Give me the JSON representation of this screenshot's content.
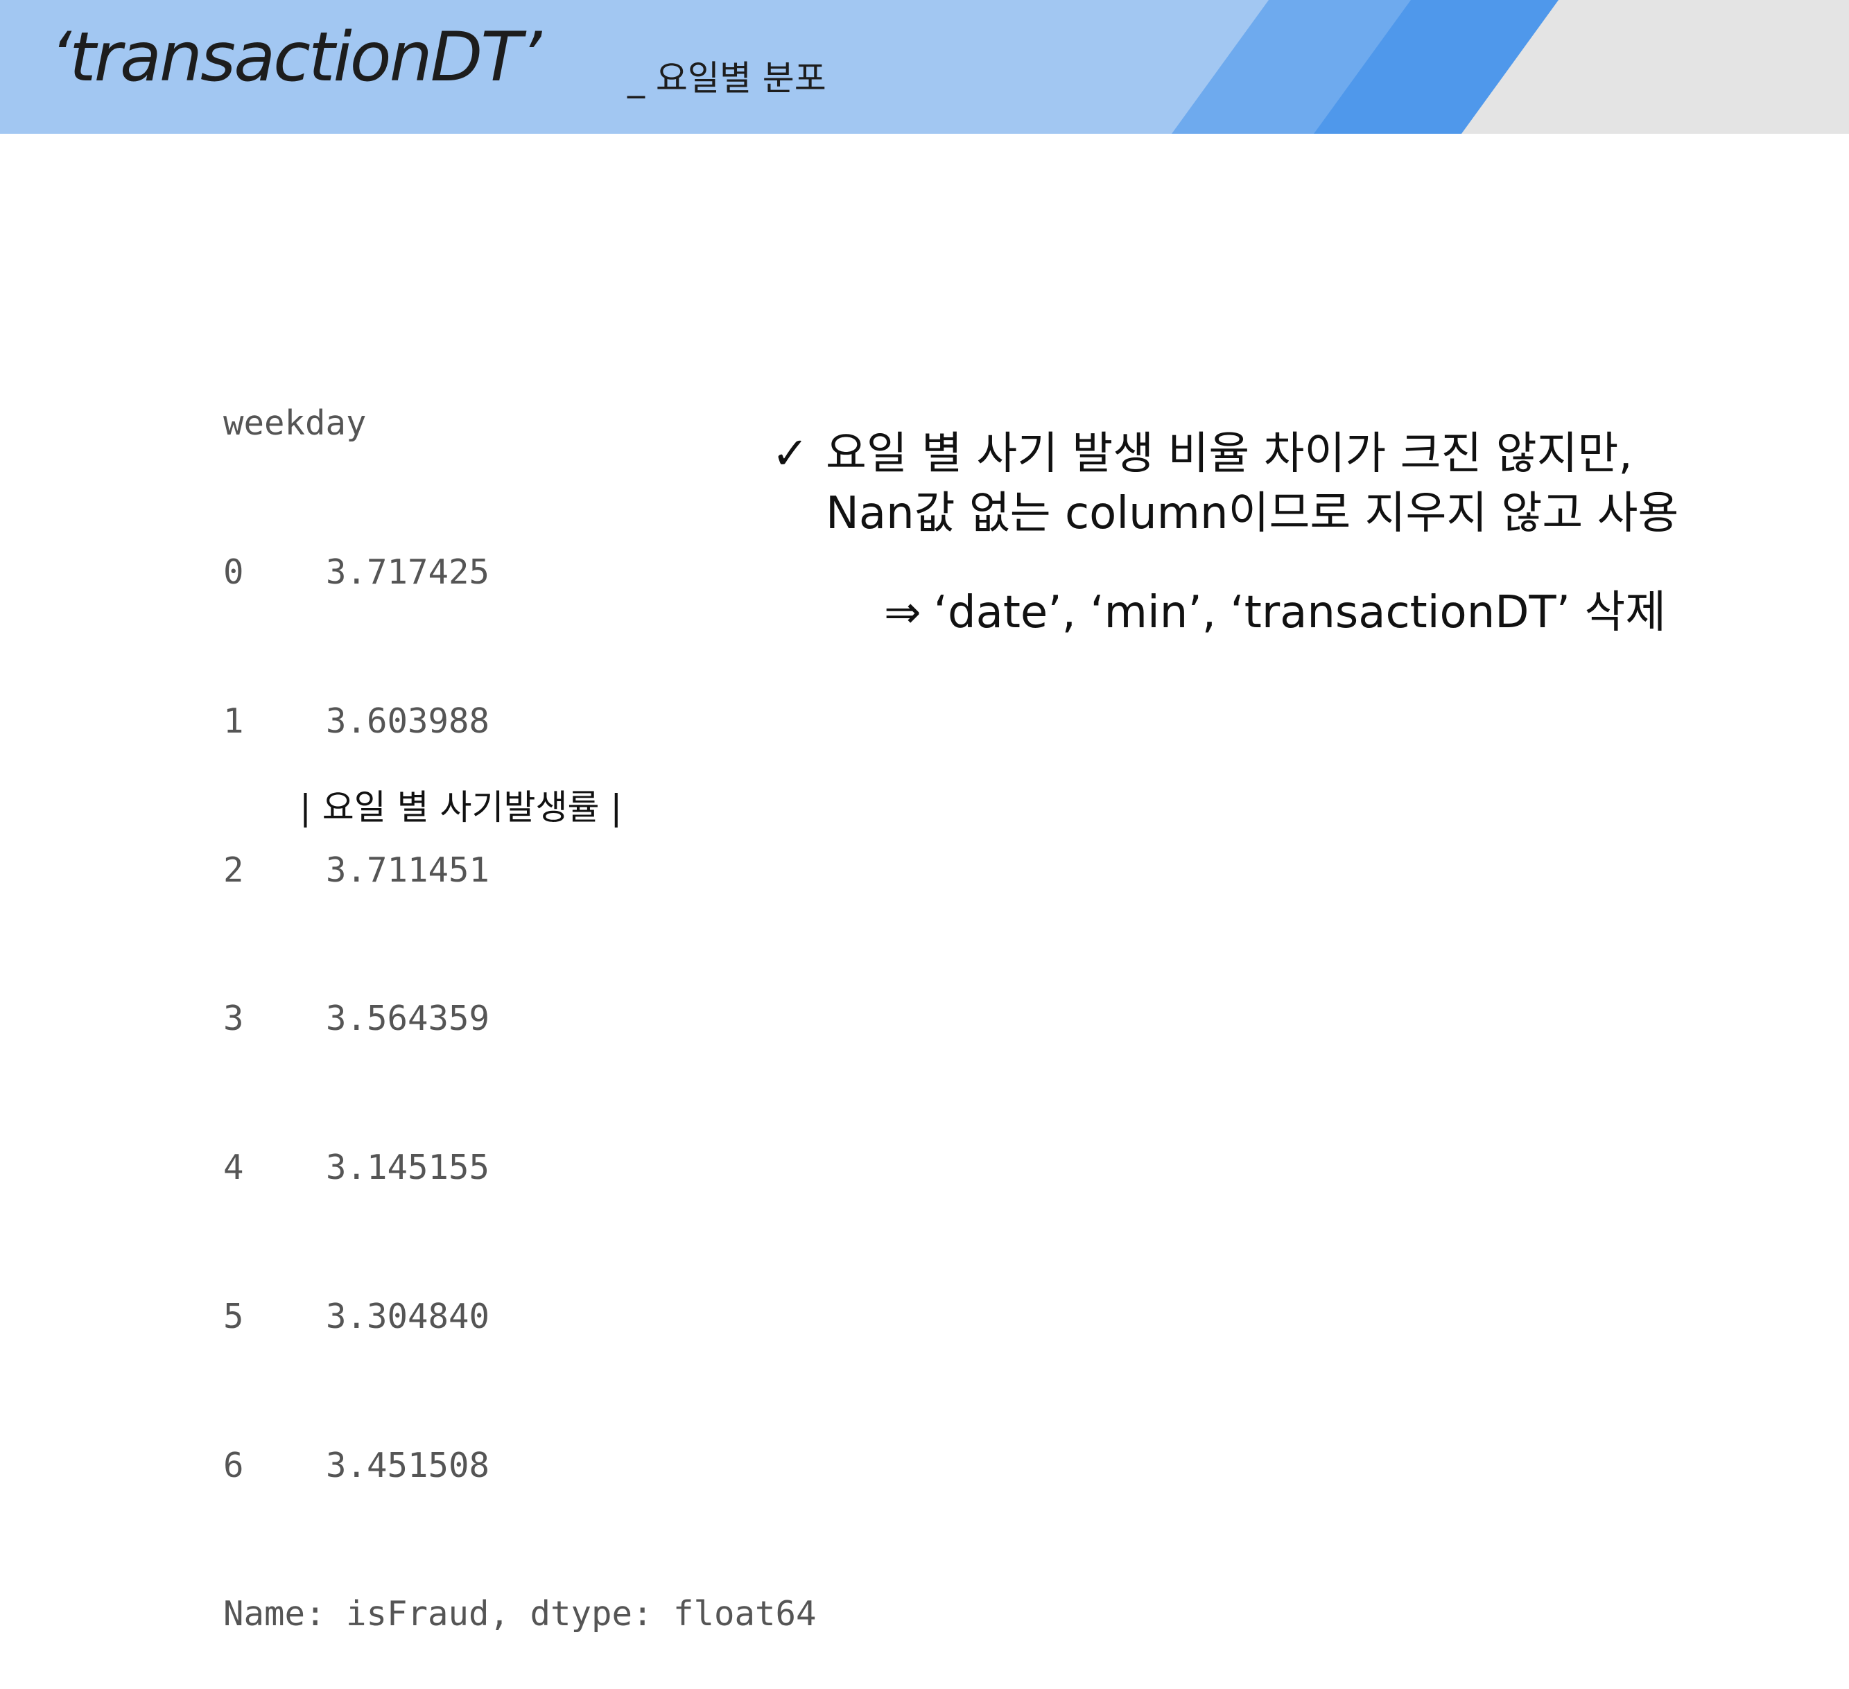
{
  "header": {
    "title": "‘transactionDT’",
    "subtitle": "_ 요일별 분포",
    "colors": {
      "band_light": "#a2c7f2",
      "stripe_mid": "#6eaaee",
      "stripe_dark": "#4f98eb",
      "corner_gray": "#e4e4e4"
    }
  },
  "output": {
    "header": "weekday",
    "rows": [
      {
        "index": "0",
        "value": "3.717425"
      },
      {
        "index": "1",
        "value": "3.603988"
      },
      {
        "index": "2",
        "value": "3.711451"
      },
      {
        "index": "3",
        "value": "3.564359"
      },
      {
        "index": "4",
        "value": "3.145155"
      },
      {
        "index": "5",
        "value": "3.304840"
      },
      {
        "index": "6",
        "value": "3.451508"
      }
    ],
    "footer": "Name: isFraud, dtype: float64",
    "caption": "| 요일 별 사기발생률 |"
  },
  "note": {
    "icon": "checkmark-icon",
    "check_glyph": "✓",
    "line1": "요일 별 사기 발생 비율 차이가 크진 않지만,",
    "line2": "Nan값 없는 column이므로 지우지 않고 사용",
    "arrow_glyph": "⇒",
    "conclusion": "‘date’, ‘min’, ‘transactionDT’ 삭제"
  }
}
